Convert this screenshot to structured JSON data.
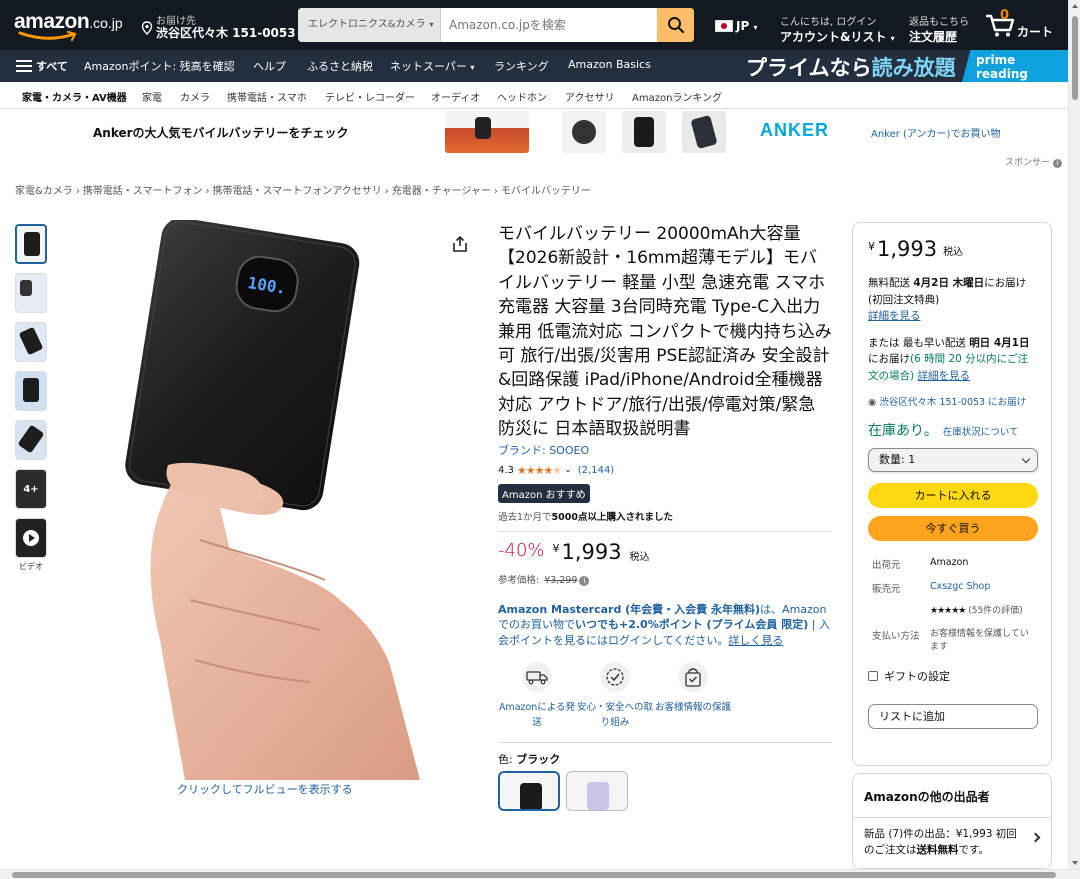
{
  "header": {
    "logo_text": "amazon",
    "logo_tld": ".co.jp",
    "deliver_label": "お届け先",
    "deliver_location": "渋谷区代々木 151-0053",
    "search_category": "エレクトロニクス&カメラ",
    "search_placeholder": "Amazon.co.jpを検索",
    "lang": "JP",
    "greeting": "こんにちは, ログイン",
    "account_label": "アカウント&リスト",
    "returns_label": "返品もこちら",
    "orders_label": "注文履歴",
    "cart_count": "0",
    "cart_label": "カート"
  },
  "nav": {
    "all_label": "すべて",
    "items": [
      "Amazonポイント: 残高を確認",
      "ヘルプ",
      "ふるさと納税",
      "ネットスーパー",
      "ランキング",
      "Amazon Basics"
    ],
    "prime_text_1": "プライムなら",
    "prime_text_2": "読み放題",
    "prime_badge_1": "prime reading"
  },
  "subnav": {
    "items": [
      "家電・カメラ・AV機器",
      "家電",
      "カメラ",
      "携帯電話・スマホ",
      "テレビ・レコーダー",
      "オーディオ",
      "ヘッドホン",
      "アクセサリ",
      "Amazonランキング"
    ]
  },
  "banner": {
    "headline": "Ankerの大人気モバイルバッテリーをチェック",
    "brand_logo": "ANKER",
    "shop_link": "Anker (アンカー)でお買い物",
    "sponsored": "スポンサー"
  },
  "breadcrumb": [
    "家電&カメラ",
    "携帯電話・スマートフォン",
    "携帯電話・スマートフォンアクセサリ",
    "充電器・チャージャー",
    "モバイルバッテリー"
  ],
  "gallery": {
    "more_count": "4+",
    "video_label": "ビデオ",
    "screen_text": "100.",
    "fullview_link": "クリックしてフルビューを表示する"
  },
  "product": {
    "title": "モバイルバッテリー 20000mAh大容量 【2026新設計・16mm超薄モデル】モバイルバッテリー 軽量 小型 急速充電 スマホ充電器 大容量 3台同時充電 Type-C入出力兼用 低電流対応 コンパクトで機内持ち込み可 旅行/出張/災害用 PSE認証済み 安全設計&回路保護 iPad/iPhone/Android全種機器対応 アウトドア/旅行/出張/停電対策/緊急防災に 日本語取扱説明書",
    "brand": "ブランド: SOOEO",
    "rating": "4.3",
    "rating_count": "(2,144)",
    "badge": "Amazon おすすめ",
    "bought_prefix": "過去1か月で",
    "bought_bold": "5000点以上購入されました",
    "discount": "-40%",
    "currency": "¥",
    "price": "1,993",
    "tax_note": "税込",
    "ref_label": "参考価格:",
    "ref_price": "¥3,299",
    "card_text_1": "Amazon Mastercard (年会費・入会費 永年無料)",
    "card_text_2": "は、Amazonでのお買い物で",
    "card_text_3": "いつでも+2.0%ポイント (プライム会員 限定)",
    "card_text_4": " | 入会ポイントを見るにはログインしてください。",
    "card_link": "詳しく見る",
    "features": [
      "Amazonによる発送",
      "安心・安全への取り組み",
      "お客様情報の保護"
    ],
    "color_label": "色:",
    "color_value": "ブラック",
    "colors": [
      "#1a1a1a",
      "#c9c3e8"
    ]
  },
  "buybox": {
    "currency": "¥",
    "price": "1,993",
    "tax_note": "税込",
    "free_ship_1": "無料配送",
    "free_ship_date": "4月2日 木曜日",
    "free_ship_2": "にお届け (初回注文特典)",
    "details_link": "詳細を見る",
    "fast_1": "または 最も早い配送",
    "fast_date": "明日 4月1日",
    "fast_2": "にお届け",
    "fast_time": "(6 時間 20 分以内にご注文の場合)",
    "fast_link": "詳細を見る",
    "location": "渋谷区代々木 151-0053 にお届け",
    "stock": "在庫あり。",
    "stock_link": "在庫状況について",
    "qty": "数量: 1",
    "add_to_cart": "カートに入れる",
    "buy_now": "今すぐ買う",
    "ship_from_label": "出荷元",
    "ship_from": "Amazon",
    "seller_label": "販売元",
    "seller": "Cxszgc Shop",
    "seller_rating": "★★★★★",
    "seller_rating_count": "(55件の評価)",
    "payment_label": "支払い方法",
    "payment": "お客様情報を保護しています",
    "gift": "ギフトの設定",
    "add_to_list": "リストに追加"
  },
  "other_sellers": {
    "heading": "Amazonの他の出品者",
    "text_1": "新品 (7)件の出品：¥1,993 初回のご注文は",
    "text_bold": "送料無料",
    "text_2": "です。"
  }
}
